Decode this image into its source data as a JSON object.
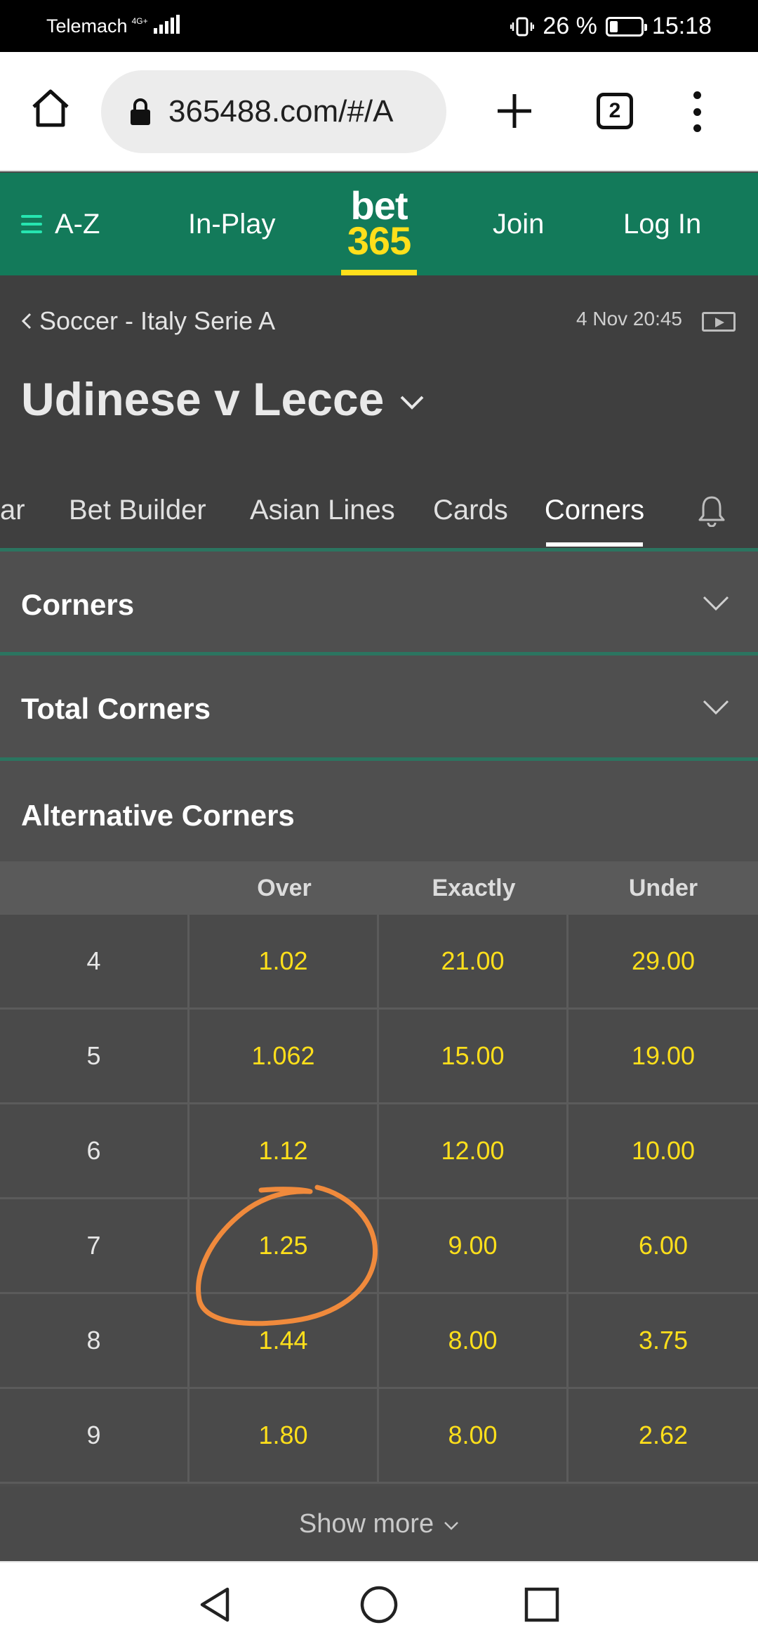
{
  "status_bar": {
    "carrier": "Telemach",
    "network": "4G+",
    "battery_text": "26 %",
    "battery_level": 0.26,
    "time": "15:18"
  },
  "browser": {
    "url": "365488.com/#/A",
    "tab_count": "2",
    "icons": [
      "home-icon",
      "lock-icon",
      "plus-icon",
      "tabs-icon",
      "menu-kebab-icon"
    ]
  },
  "site_header": {
    "menu_label": "A-Z",
    "inplay_label": "In-Play",
    "logo_line1": "bet",
    "logo_line2": "365",
    "join_label": "Join",
    "login_label": "Log In",
    "colors": {
      "header_bg": "#137a5a",
      "brand_yellow": "#ffdf1b",
      "menu_accent": "#26e5b0"
    }
  },
  "event": {
    "breadcrumb": "Soccer - Italy Serie A",
    "datetime": "4 Nov 20:45",
    "title": "Udinese v Lecce",
    "tabs": [
      {
        "label": "ar"
      },
      {
        "label": "Bet Builder"
      },
      {
        "label": "Asian Lines"
      },
      {
        "label": "Cards"
      },
      {
        "label": "Corners",
        "active": true
      }
    ]
  },
  "markets": {
    "corners": "Corners",
    "total_corners": "Total Corners",
    "alternative_corners": "Alternative Corners"
  },
  "odds_table": {
    "headers": {
      "over": "Over",
      "exactly": "Exactly",
      "under": "Under"
    },
    "rows": [
      {
        "line": "4",
        "over": "1.02",
        "exactly": "21.00",
        "under": "29.00"
      },
      {
        "line": "5",
        "over": "1.062",
        "exactly": "15.00",
        "under": "19.00"
      },
      {
        "line": "6",
        "over": "1.12",
        "exactly": "12.00",
        "under": "10.00"
      },
      {
        "line": "7",
        "over": "1.25",
        "exactly": "9.00",
        "under": "6.00"
      },
      {
        "line": "8",
        "over": "1.44",
        "exactly": "8.00",
        "under": "3.75"
      },
      {
        "line": "9",
        "over": "1.80",
        "exactly": "8.00",
        "under": "2.62"
      }
    ],
    "annotation_color": "#f08a3c"
  },
  "show_more": "Show more"
}
